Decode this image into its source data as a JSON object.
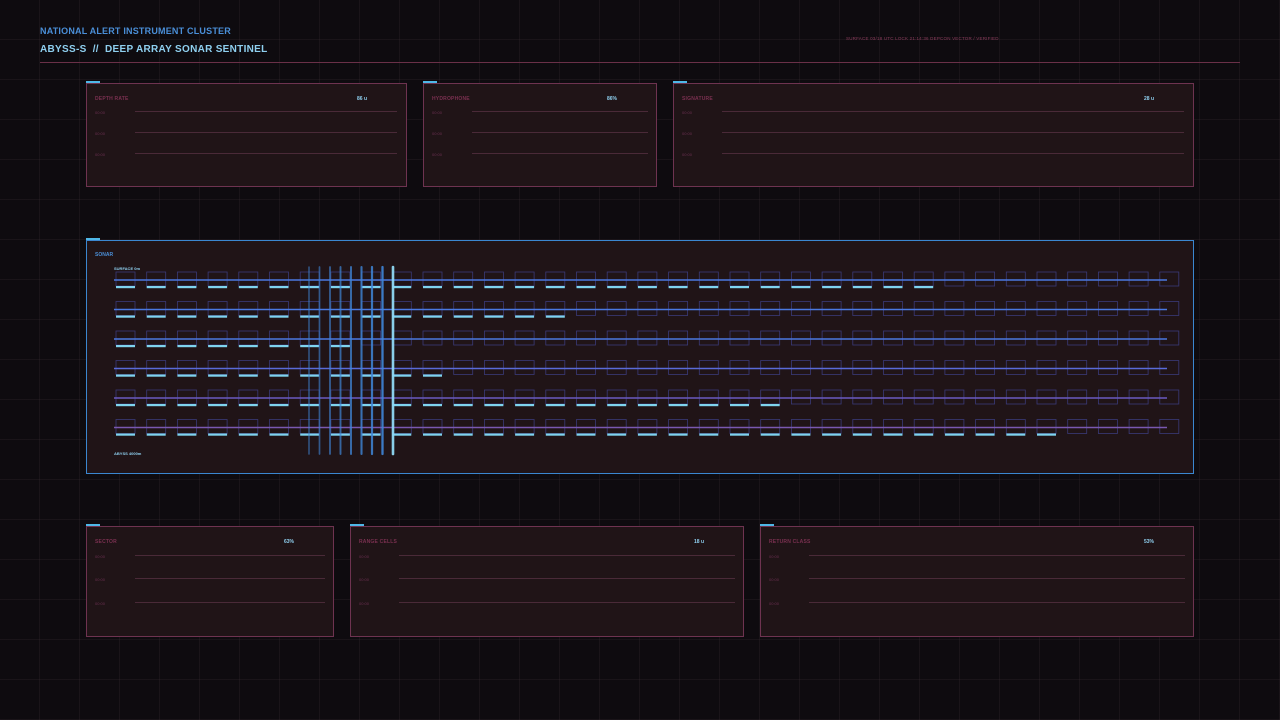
{
  "header": {
    "cluster": "NATIONAL ALERT INSTRUMENT CLUSTER",
    "title": "ABYSS-S  //  DEEP ARRAY SONAR SENTINEL",
    "status": "SURFACE 03/18  UTC LOCK  21:14:36  DEPCON VECTOR / VERIFIED"
  },
  "top_panels": [
    {
      "title": "DEPTH RATE",
      "value": "86 u",
      "rows": [
        "00:00",
        "00:00",
        "00:00"
      ]
    },
    {
      "title": "HYDROPHONE",
      "value": "86%",
      "rows": [
        "00:00",
        "00:00",
        "00:00"
      ]
    },
    {
      "title": "SIGNATURE",
      "value": "28 u",
      "rows": [
        "00:00",
        "00:00",
        "00:00"
      ]
    }
  ],
  "sonar": {
    "title": "SONAR",
    "top_label": "SURFACE 0m",
    "bottom_label": "ABYSS 4000m",
    "columns": 35,
    "lanes": [
      {
        "fill": 27,
        "color": "#4a78e0"
      },
      {
        "fill": 15,
        "color": "#4a78e0"
      },
      {
        "fill": 8,
        "color": "#4a78e0"
      },
      {
        "fill": 11,
        "color": "#5a6ad8"
      },
      {
        "fill": 22,
        "color": "#6a5ac0"
      },
      {
        "fill": 31,
        "color": "#7a58b0"
      }
    ],
    "sweep_bars": 9,
    "accent": "#7fd4ef"
  },
  "bottom_panels": [
    {
      "title": "SECTOR",
      "value": "63%",
      "rows": [
        "00:00",
        "00:00",
        "00:00"
      ]
    },
    {
      "title": "RANGE CELLS",
      "value": "18 u",
      "rows": [
        "00:00",
        "00:00",
        "00:00"
      ]
    },
    {
      "title": "RETURN CLASS",
      "value": "53%",
      "rows": [
        "00:00",
        "00:00",
        "00:00"
      ]
    }
  ]
}
